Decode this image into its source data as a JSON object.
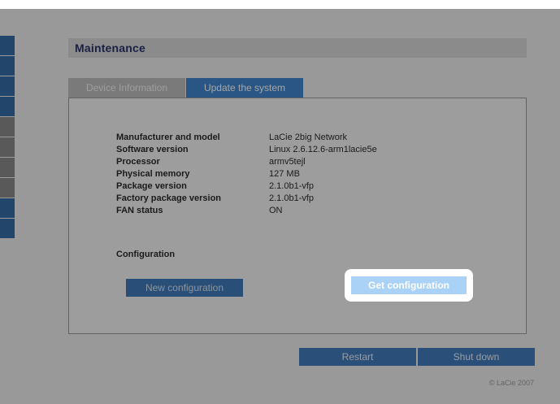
{
  "header": {
    "title": "Maintenance"
  },
  "tabs": [
    {
      "label": "Device Information",
      "active": false
    },
    {
      "label": "Update the system",
      "active": true
    }
  ],
  "device_info": [
    {
      "label": "Manufacturer and model",
      "value": "LaCie 2big Network"
    },
    {
      "label": "Software version",
      "value": "Linux 2.6.12.6-arm1lacie5e"
    },
    {
      "label": "Processor",
      "value": "armv5tejl"
    },
    {
      "label": "Physical memory",
      "value": "127 MB"
    },
    {
      "label": "Package version",
      "value": "2.1.0b1-vfp"
    },
    {
      "label": "Factory package version",
      "value": "2.1.0b1-vfp"
    },
    {
      "label": "FAN status",
      "value": "ON"
    }
  ],
  "configuration": {
    "heading": "Configuration",
    "new_label": "New configuration",
    "get_label": "Get configuration"
  },
  "actions": {
    "restart_label": "Restart",
    "shutdown_label": "Shut down"
  },
  "footer": {
    "copyright": "© LaCie 2007"
  },
  "colors": {
    "brand_blue": "#2b78ca",
    "highlight_blue": "#aad2f6"
  },
  "state": {
    "highlighted_button": "Get configuration"
  }
}
